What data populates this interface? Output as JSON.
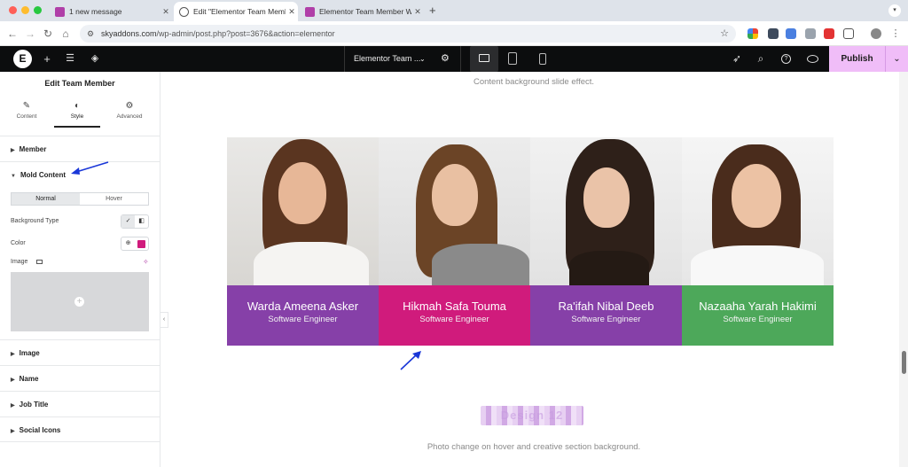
{
  "browser": {
    "tabs": [
      {
        "title": "1 new message",
        "favicon_color": "#b03fa8"
      },
      {
        "title": "Edit \"Elementor Team Membe",
        "favicon_color": "#5a5a5a"
      },
      {
        "title": "Elementor Team Member Wid",
        "favicon_color": "#b03fa8"
      }
    ],
    "url_host": "skyaddons.com",
    "url_path": "/wp-admin/post.php?post=3676&action=elementor",
    "new_tab": "+"
  },
  "editor": {
    "document_title": "Elementor Team ...",
    "publish_label": "Publish"
  },
  "panel": {
    "title": "Edit Team Member",
    "tabs": [
      "Content",
      "Style",
      "Advanced"
    ],
    "sections": [
      "Member",
      "Mold Content",
      "Image",
      "Name",
      "Job Title",
      "Social Icons"
    ],
    "state_tabs": [
      "Normal",
      "Hover"
    ],
    "bg_type_label": "Background Type",
    "color_label": "Color",
    "image_label": "Image",
    "swatch_color": "#d01b7c"
  },
  "canvas": {
    "top_note": "Content background slide effect.",
    "members": [
      {
        "name": "Warda Ameena Asker",
        "role": "Software Engineer",
        "band_color": "#8640a8"
      },
      {
        "name": "Hikmah Safa Touma",
        "role": "Software Engineer",
        "band_color": "#d01b7c"
      },
      {
        "name": "Ra'ifah Nibal Deeb",
        "role": "Software Engineer",
        "band_color": "#8640a8"
      },
      {
        "name": "Nazaaha Yarah Hakimi",
        "role": "Software Engineer",
        "band_color": "#4da85a"
      }
    ],
    "design_heading": "Design 12",
    "bottom_note": "Photo change on hover and creative section background."
  }
}
